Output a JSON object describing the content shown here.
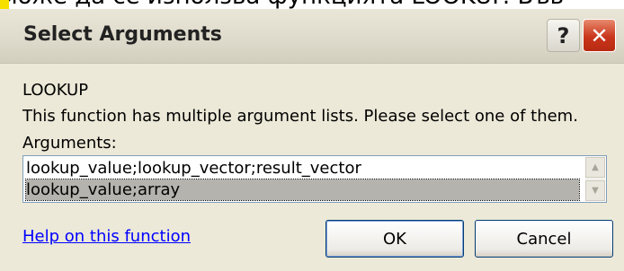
{
  "background_text": "може да се използва функцията LOOKUP. Във",
  "dialog": {
    "title": "Select Arguments",
    "help_glyph": "?",
    "close_glyph": "✕",
    "function_name": "LOOKUP",
    "description": "This function has multiple argument lists.  Please select one of them.",
    "arguments_label": "Arguments:",
    "argument_lists": [
      "lookup_value;lookup_vector;result_vector",
      "lookup_value;array"
    ],
    "selected_index": 1,
    "scroll_up_glyph": "▲",
    "scroll_down_glyph": "▼",
    "help_link": "Help on this function",
    "ok_label": "OK",
    "cancel_label": "Cancel"
  },
  "colors": {
    "titlebar": "#dedacb",
    "dialog_bg": "#ece9d8",
    "close_red": "#c9361b",
    "link_blue": "#0000ff",
    "selection": "#b5b3ad"
  },
  "icons": [
    "help-icon",
    "close-icon",
    "scroll-up-icon",
    "scroll-down-icon"
  ]
}
